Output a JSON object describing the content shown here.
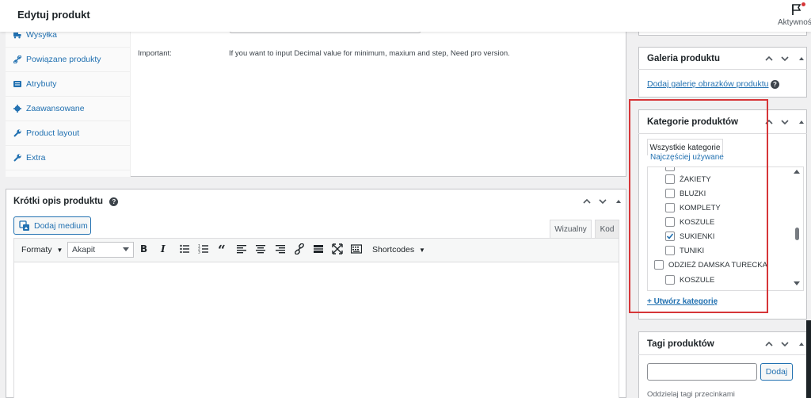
{
  "header": {
    "title": "Edytuj produkt",
    "activity_label": "Aktywność"
  },
  "product_data": {
    "tabs": [
      {
        "label": "Wysyłka",
        "icon": "truck-icon"
      },
      {
        "label": "Powiązane produkty",
        "icon": "link-icon"
      },
      {
        "label": "Atrybuty",
        "icon": "list-icon"
      },
      {
        "label": "Zaawansowane",
        "icon": "gear-icon"
      },
      {
        "label": "Product layout",
        "icon": "wrench-icon"
      },
      {
        "label": "Extra",
        "icon": "wrench-icon"
      }
    ],
    "important_label": "Important:",
    "important_text": "If you want to input Decimal value for minimum, maxium and step, Need pro version."
  },
  "short_description": {
    "title": "Krótki opis produktu",
    "add_media_label": "Dodaj medium",
    "tab_visual": "Wizualny",
    "tab_code": "Kod",
    "format_label": "Formaty",
    "paragraph_value": "Akapit",
    "shortcodes_label": "Shortcodes"
  },
  "gallery": {
    "title": "Galeria produktu",
    "link": "Dodaj galerię obrazków produktu"
  },
  "categories": {
    "title": "Kategorie produktów",
    "tab_all": "Wszystkie kategorie",
    "tab_popular": "Najczęściej używane",
    "items": [
      {
        "label": "ŻAKIETY",
        "checked": false,
        "level": 1
      },
      {
        "label": "BLUZKI",
        "checked": false,
        "level": 1
      },
      {
        "label": "KOMPLETY",
        "checked": false,
        "level": 1
      },
      {
        "label": "KOSZULE",
        "checked": false,
        "level": 1
      },
      {
        "label": "SUKIENKI",
        "checked": true,
        "level": 1
      },
      {
        "label": "TUNIKI",
        "checked": false,
        "level": 1
      },
      {
        "label": "ODZIEŻ DAMSKA TURECKA",
        "checked": false,
        "level": 0
      },
      {
        "label": "KOSZULE",
        "checked": false,
        "level": 1
      }
    ],
    "create_link": "+ Utwórz kategorię"
  },
  "tags": {
    "title": "Tagi produktów",
    "add_button": "Dodaj",
    "hint": "Oddzielaj tagi przecinkami"
  },
  "colors": {
    "accent": "#2271b1",
    "highlight": "#d63638"
  }
}
